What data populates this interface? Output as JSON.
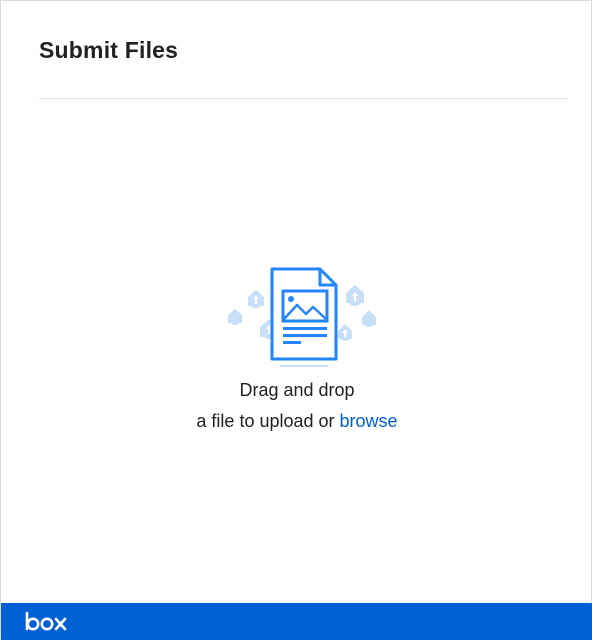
{
  "header": {
    "title": "Submit Files"
  },
  "dropzone": {
    "line1": "Drag and drop",
    "line2_prefix": "a file to upload or ",
    "browse_label": "browse",
    "illustration_icon": "file-upload-illustration-icon"
  },
  "footer": {
    "logo_text": "box",
    "logo_icon": "box-logo-icon",
    "background_color": "#0061d5"
  },
  "colors": {
    "accent": "#0061d5",
    "illustration_blue": "#2486fc",
    "illustration_light": "#c7dff9",
    "text": "#222222"
  }
}
